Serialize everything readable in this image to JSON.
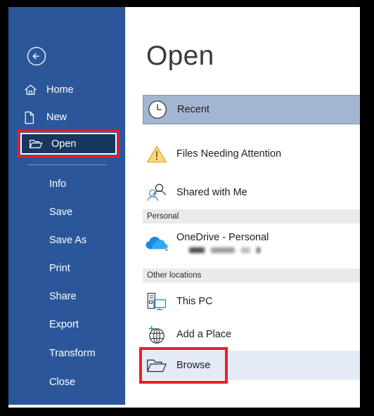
{
  "app": {
    "title": "Open",
    "back_button": "back-arrow"
  },
  "nav": {
    "top_items": [
      {
        "label": "Home",
        "icon": "home-icon"
      },
      {
        "label": "New",
        "icon": "new-document-icon"
      },
      {
        "label": "Open",
        "icon": "folder-open-icon",
        "selected": true,
        "highlighted": true
      }
    ],
    "bottom_items": [
      {
        "label": "Info"
      },
      {
        "label": "Save"
      },
      {
        "label": "Save As"
      },
      {
        "label": "Print"
      },
      {
        "label": "Share"
      },
      {
        "label": "Export"
      },
      {
        "label": "Transform"
      },
      {
        "label": "Close"
      }
    ]
  },
  "open_pane": {
    "heading": "Open",
    "places": [
      {
        "label": "Recent",
        "icon": "clock-icon",
        "selected": true
      },
      {
        "label": "Files Needing Attention",
        "icon": "warning-triangle-icon"
      },
      {
        "label": "Shared with Me",
        "icon": "people-icon"
      }
    ],
    "sections": [
      {
        "header": "Personal",
        "items": [
          {
            "label": "OneDrive - Personal",
            "icon": "onedrive-cloud-icon",
            "subtitle_redacted": true
          }
        ]
      },
      {
        "header": "Other locations",
        "items": [
          {
            "label": "This PC",
            "icon": "this-pc-icon"
          },
          {
            "label": "Add a Place",
            "icon": "add-a-place-globe-icon"
          },
          {
            "label": "Browse",
            "icon": "folder-icon",
            "hovered": true,
            "highlighted": true
          }
        ]
      }
    ]
  },
  "colors": {
    "nav_blue": "#2b579a",
    "nav_selected": "#17375e",
    "recent_selected": "#a3b6d1",
    "browse_hover": "#e3ebf7",
    "annotation_red": "#ee1c25",
    "section_header_bg": "#eaeaea"
  }
}
